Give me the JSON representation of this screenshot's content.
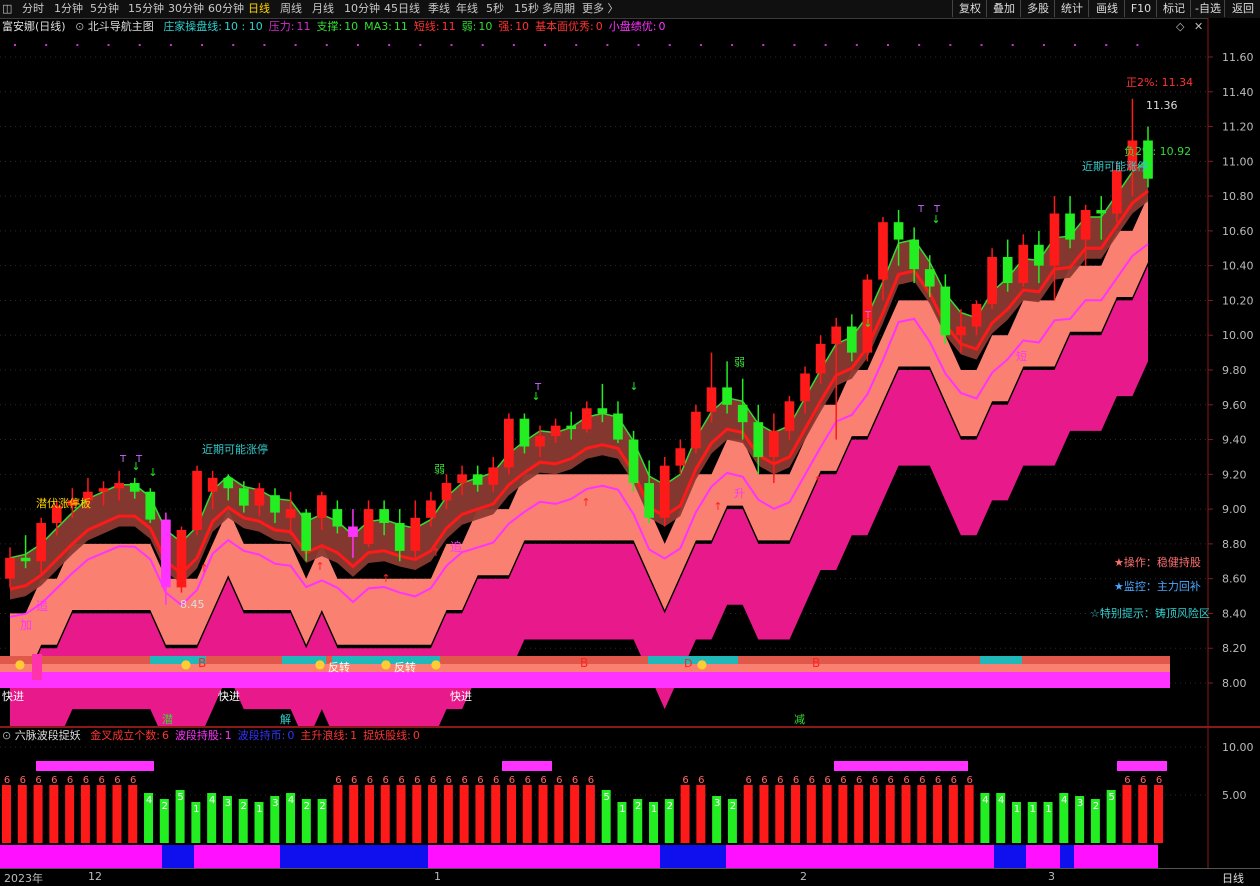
{
  "toolbar": {
    "tabs": [
      "分时",
      "1分钟",
      "5分钟",
      "15分钟",
      "30分钟",
      "60分钟",
      "日线",
      "周线",
      "月线",
      "10分钟",
      "45日线",
      "季线",
      "年线",
      "5秒",
      "15秒",
      "多周期",
      "更多 〉"
    ],
    "active": "日线",
    "right_buttons": [
      "复权",
      "叠加",
      "多股",
      "统计",
      "画线",
      "F10",
      "标记",
      "-自选",
      "返回"
    ]
  },
  "main_header": {
    "stock": "富安娜(日线)",
    "indicator": "北斗导航主图",
    "items": [
      {
        "label": "庄家操盘线:",
        "value": "10 : 10",
        "color": "#2fd0d0"
      },
      {
        "label": "压力:",
        "value": "11",
        "color": "#cc33cc"
      },
      {
        "label": "支撑:",
        "value": "10",
        "color": "#33dd33"
      },
      {
        "label": "MA3:",
        "value": "11",
        "color": "#33dd33"
      },
      {
        "label": "短线:",
        "value": "11",
        "color": "#ff3333"
      },
      {
        "label": "弱:",
        "value": "10",
        "color": "#33dd33"
      },
      {
        "label": "强:",
        "value": "10",
        "color": "#ff3333"
      },
      {
        "label": "基本面优秀:",
        "value": "0",
        "color": "#ff3333"
      },
      {
        "label": "小盘绩优:",
        "value": "0",
        "color": "#ff33ff"
      }
    ]
  },
  "sub_header": {
    "indicator": "六脉波段捉妖",
    "items": [
      {
        "label": "金叉成立个数:",
        "value": "6",
        "color": "#ff3333"
      },
      {
        "label": "波段持股:",
        "value": "1",
        "color": "#ff33ff"
      },
      {
        "label": "波段持币:",
        "value": "0",
        "color": "#3333ff"
      },
      {
        "label": "主升浪线:",
        "value": "1",
        "color": "#ff3333"
      },
      {
        "label": "捉妖股线:",
        "value": "0",
        "color": "#ff3333"
      }
    ]
  },
  "annotations": {
    "pos2": "正2%: 11.34",
    "neg2": "负2%: 10.92",
    "high": "11.36",
    "low": "8.45",
    "limit_up_1": "近期可能涨停",
    "limit_up_2": "近期可能涨停",
    "hidden_board": "潜伏涨停板",
    "op": "★操作：稳健持股",
    "monitor": "★监控：主力回补",
    "tip": "☆特别提示：铸顶风险区",
    "chase1": "追",
    "chase2": "追",
    "add": "加",
    "weak1": "弱",
    "weak2": "弱",
    "rise": "升",
    "short": "短",
    "fast1": "快进",
    "fast2": "快进",
    "fast3": "快进",
    "b1": "B",
    "b2": "B",
    "b3": "B",
    "d1": "D",
    "turn1": "反转",
    "turn2": "反转",
    "qian": "潜",
    "jie": "解",
    "jian": "减"
  },
  "x_axis": {
    "year": "2023年",
    "m12": "12",
    "m1": "1",
    "m2": "2",
    "m3": "3",
    "period": "日线"
  },
  "chart_data": [
    {
      "type": "candlestick",
      "title": "北斗导航主图",
      "ylim": [
        7.85,
        11.75
      ],
      "yticks": [
        8.0,
        8.2,
        8.4,
        8.6,
        8.8,
        9.0,
        9.2,
        9.4,
        9.6,
        9.8,
        10.0,
        10.2,
        10.4,
        10.6,
        10.8,
        11.0,
        11.2,
        11.4,
        11.6
      ],
      "ohlc": [
        [
          8.6,
          8.78,
          8.55,
          8.72
        ],
        [
          8.72,
          8.85,
          8.66,
          8.7
        ],
        [
          8.7,
          8.95,
          8.62,
          8.92
        ],
        [
          8.92,
          9.05,
          8.85,
          9.02
        ],
        [
          9.02,
          9.12,
          8.95,
          9.05
        ],
        [
          9.05,
          9.18,
          9.0,
          9.1
        ],
        [
          9.1,
          9.16,
          9.02,
          9.12
        ],
        [
          9.12,
          9.22,
          9.05,
          9.15
        ],
        [
          9.15,
          9.18,
          9.06,
          9.1
        ],
        [
          9.1,
          9.12,
          8.92,
          8.94
        ],
        [
          8.94,
          8.98,
          8.45,
          8.55
        ],
        [
          8.55,
          8.9,
          8.52,
          8.88
        ],
        [
          8.88,
          9.25,
          8.85,
          9.22
        ],
        [
          9.1,
          9.22,
          9.0,
          9.18
        ],
        [
          9.18,
          9.2,
          9.05,
          9.12
        ],
        [
          9.12,
          9.16,
          8.98,
          9.02
        ],
        [
          9.02,
          9.15,
          8.96,
          9.12
        ],
        [
          9.08,
          9.12,
          8.92,
          8.98
        ],
        [
          8.95,
          9.1,
          8.85,
          9.0
        ],
        [
          8.98,
          9.0,
          8.7,
          8.76
        ],
        [
          8.95,
          9.1,
          8.88,
          9.08
        ],
        [
          9.0,
          9.05,
          8.86,
          8.9
        ],
        [
          8.9,
          9.0,
          8.72,
          8.84
        ],
        [
          8.8,
          9.05,
          8.78,
          9.0
        ],
        [
          9.0,
          9.05,
          8.85,
          8.92
        ],
        [
          8.92,
          9.0,
          8.7,
          8.76
        ],
        [
          8.76,
          9.05,
          8.72,
          8.95
        ],
        [
          8.95,
          9.1,
          8.9,
          9.05
        ],
        [
          9.05,
          9.2,
          9.0,
          9.15
        ],
        [
          9.15,
          9.25,
          9.08,
          9.2
        ],
        [
          9.2,
          9.25,
          9.1,
          9.14
        ],
        [
          9.14,
          9.3,
          9.1,
          9.24
        ],
        [
          9.24,
          9.55,
          9.2,
          9.52
        ],
        [
          9.52,
          9.55,
          9.32,
          9.36
        ],
        [
          9.36,
          9.48,
          9.3,
          9.42
        ],
        [
          9.42,
          9.52,
          9.38,
          9.48
        ],
        [
          9.48,
          9.56,
          9.4,
          9.46
        ],
        [
          9.46,
          9.62,
          9.44,
          9.58
        ],
        [
          9.58,
          9.72,
          9.5,
          9.55
        ],
        [
          9.55,
          9.62,
          9.38,
          9.4
        ],
        [
          9.4,
          9.45,
          9.1,
          9.15
        ],
        [
          9.15,
          9.28,
          8.92,
          8.95
        ],
        [
          8.95,
          9.3,
          8.9,
          9.25
        ],
        [
          9.25,
          9.4,
          9.2,
          9.35
        ],
        [
          9.35,
          9.6,
          9.32,
          9.56
        ],
        [
          9.56,
          9.9,
          9.5,
          9.7
        ],
        [
          9.7,
          9.85,
          9.55,
          9.6
        ],
        [
          9.6,
          9.75,
          9.4,
          9.5
        ],
        [
          9.5,
          9.6,
          9.2,
          9.3
        ],
        [
          9.3,
          9.55,
          9.15,
          9.45
        ],
        [
          9.45,
          9.65,
          9.4,
          9.62
        ],
        [
          9.62,
          9.82,
          9.55,
          9.78
        ],
        [
          9.78,
          10.0,
          9.72,
          9.95
        ],
        [
          9.95,
          10.1,
          9.4,
          10.05
        ],
        [
          10.05,
          10.12,
          9.85,
          9.9
        ],
        [
          9.9,
          10.35,
          9.85,
          10.32
        ],
        [
          10.32,
          10.68,
          10.2,
          10.65
        ],
        [
          10.65,
          10.72,
          10.4,
          10.55
        ],
        [
          10.55,
          10.62,
          10.3,
          10.38
        ],
        [
          10.38,
          10.46,
          10.22,
          10.28
        ],
        [
          10.28,
          10.35,
          9.95,
          10.0
        ],
        [
          10.0,
          10.15,
          9.9,
          10.05
        ],
        [
          10.05,
          10.2,
          10.0,
          10.18
        ],
        [
          10.18,
          10.5,
          10.15,
          10.45
        ],
        [
          10.45,
          10.55,
          10.25,
          10.3
        ],
        [
          10.3,
          10.58,
          10.28,
          10.52
        ],
        [
          10.52,
          10.6,
          10.3,
          10.4
        ],
        [
          10.4,
          10.8,
          10.2,
          10.7
        ],
        [
          10.7,
          10.8,
          10.5,
          10.55
        ],
        [
          10.55,
          10.75,
          10.4,
          10.72
        ],
        [
          10.72,
          10.8,
          10.55,
          10.7
        ],
        [
          10.7,
          11.0,
          10.65,
          10.95
        ],
        [
          10.95,
          11.36,
          10.8,
          11.12
        ],
        [
          11.12,
          11.2,
          10.85,
          10.9
        ]
      ],
      "series": [
        {
          "name": "MA3",
          "values": [
            8.7,
            8.72,
            8.78,
            8.87,
            8.96,
            9.04,
            9.08,
            9.12,
            9.12,
            9.05,
            8.86,
            8.79,
            8.88,
            9.09,
            9.17,
            9.11,
            9.09,
            9.04,
            9.03,
            8.91,
            8.95,
            8.91,
            8.83,
            8.91,
            8.92,
            8.89,
            8.87,
            8.92,
            9.05,
            9.13,
            9.16,
            9.19,
            9.3,
            9.37,
            9.43,
            9.42,
            9.45,
            9.51,
            9.53,
            9.51,
            9.37,
            9.17,
            9.12,
            9.18,
            9.39,
            9.54,
            9.62,
            9.6,
            9.47,
            9.42,
            9.46,
            9.62,
            9.78,
            9.93,
            9.97,
            10.09,
            10.29,
            10.51,
            10.53,
            10.4,
            10.22,
            10.11,
            10.08,
            10.23,
            10.31,
            10.42,
            10.41,
            10.54,
            10.55,
            10.66,
            10.66,
            10.79,
            10.92,
            10.99
          ]
        }
      ]
    },
    {
      "type": "bar",
      "title": "六脉波段捉妖",
      "ylim": [
        0,
        11
      ],
      "yticks": [
        5.0,
        10.0
      ],
      "values": [
        6,
        6,
        6,
        6,
        6,
        6,
        6,
        6,
        6,
        4,
        2,
        5,
        1,
        4,
        3,
        2,
        1,
        3,
        4,
        2,
        2,
        6,
        6,
        6,
        6,
        6,
        6,
        6,
        6,
        6,
        6,
        6,
        6,
        6,
        6,
        6,
        6,
        6,
        5,
        1,
        2,
        1,
        2,
        6,
        6,
        3,
        2,
        6,
        6,
        6,
        6,
        6,
        6,
        6,
        6,
        6,
        6,
        6,
        6,
        6,
        6,
        6,
        4,
        4,
        1,
        1,
        1,
        4,
        3,
        2,
        5,
        6,
        6,
        6
      ]
    }
  ]
}
